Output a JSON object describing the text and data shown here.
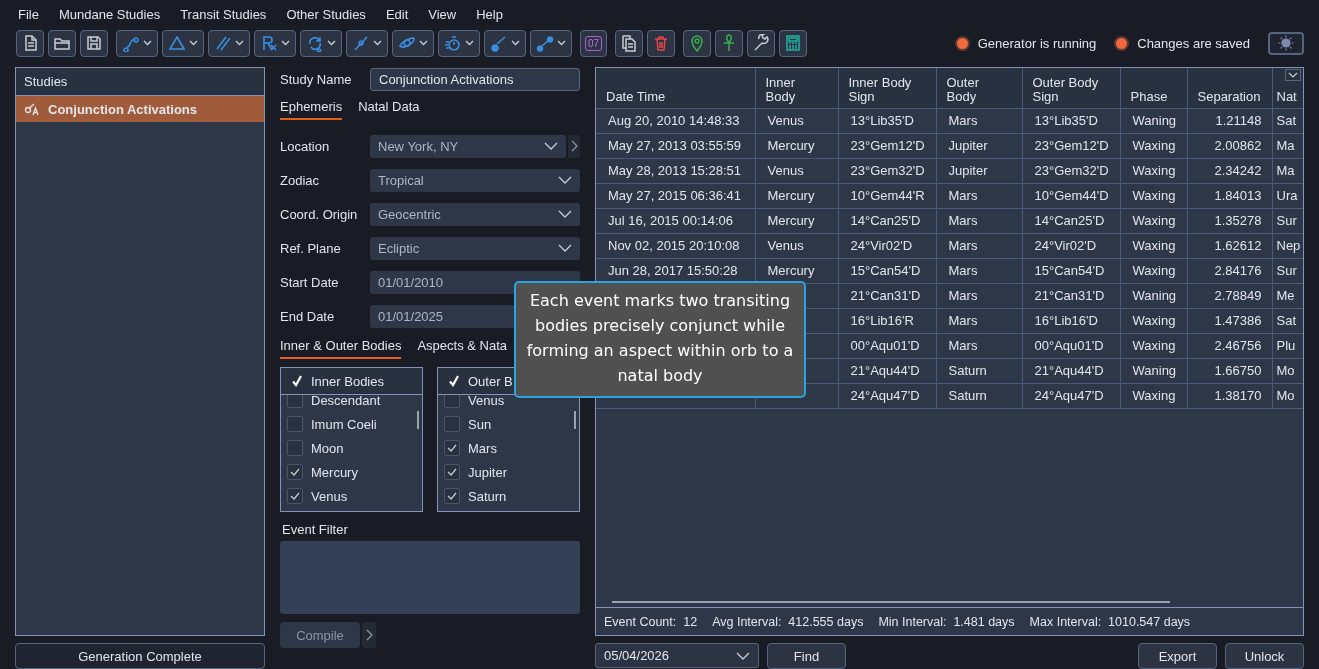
{
  "menu": [
    "File",
    "Mundane Studies",
    "Transit Studies",
    "Other Studies",
    "Edit",
    "View",
    "Help"
  ],
  "toolbar": {
    "calendar_day": "07"
  },
  "status": [
    {
      "label": "Generator is running",
      "on": true
    },
    {
      "label": "Changes are saved",
      "on": true
    }
  ],
  "studies": {
    "title": "Studies",
    "items": [
      {
        "label": "Conjunction Activations",
        "selected": true
      }
    ],
    "button": "Generation Complete"
  },
  "study_name": {
    "label": "Study Name",
    "value": "Conjunction Activations"
  },
  "tabs": [
    {
      "label": "Ephemeris",
      "selected": true
    },
    {
      "label": "Natal Data",
      "selected": false
    }
  ],
  "fields": [
    {
      "label": "Location",
      "value": "New York, NY",
      "kind": "select",
      "side_button": true
    },
    {
      "label": "Zodiac",
      "value": "Tropical",
      "kind": "select"
    },
    {
      "label": "Coord. Origin",
      "value": "Geocentric",
      "kind": "select"
    },
    {
      "label": "Ref. Plane",
      "value": "Ecliptic",
      "kind": "select"
    },
    {
      "label": "Start Date",
      "value": "01/01/2010",
      "kind": "date"
    },
    {
      "label": "End Date",
      "value": "01/01/2025",
      "kind": "date"
    }
  ],
  "body_tabs": [
    {
      "label": "Inner & Outer Bodies",
      "selected": true
    },
    {
      "label": "Aspects & Nata",
      "selected": false
    }
  ],
  "body_lists": [
    {
      "title": "Inner Bodies",
      "checked": true,
      "items": [
        {
          "label": "Descendant",
          "checked": false
        },
        {
          "label": "Imum Coeli",
          "checked": false
        },
        {
          "label": "Moon",
          "checked": false
        },
        {
          "label": "Mercury",
          "checked": true
        },
        {
          "label": "Venus",
          "checked": true
        }
      ]
    },
    {
      "title": "Outer B",
      "checked": true,
      "items": [
        {
          "label": "Venus",
          "checked": false
        },
        {
          "label": "Sun",
          "checked": false
        },
        {
          "label": "Mars",
          "checked": true
        },
        {
          "label": "Jupiter",
          "checked": true
        },
        {
          "label": "Saturn",
          "checked": true
        }
      ]
    }
  ],
  "event_filter": {
    "label": "Event Filter"
  },
  "compile": {
    "label": "Compile",
    "disabled": true
  },
  "table": {
    "columns": [
      {
        "label": "Date Time"
      },
      {
        "label": "Inner Body"
      },
      {
        "label": "Inner Body Sign"
      },
      {
        "label": "Outer Body"
      },
      {
        "label": "Outer Body Sign"
      },
      {
        "label": "Phase"
      },
      {
        "label": "Separation",
        "kind": "number"
      },
      {
        "label": "Nat"
      }
    ],
    "rows": [
      {
        "cells": [
          "Aug 20, 2010 14:48:33",
          "Venus",
          "13°Lib35'D",
          "Mars",
          "13°Lib35'D",
          "Waning",
          "1.21148",
          "Sat"
        ]
      },
      {
        "cells": [
          "May 27, 2013 03:55:59",
          "Mercury",
          "23°Gem12'D",
          "Jupiter",
          "23°Gem12'D",
          "Waxing",
          "2.00862",
          "Ma"
        ]
      },
      {
        "cells": [
          "May 28, 2013 15:28:51",
          "Venus",
          "23°Gem32'D",
          "Jupiter",
          "23°Gem32'D",
          "Waxing",
          "2.34242",
          "Ma"
        ]
      },
      {
        "cells": [
          "May 27, 2015 06:36:41",
          "Mercury",
          "10°Gem44'R",
          "Mars",
          "10°Gem44'D",
          "Waxing",
          "1.84013",
          "Ura"
        ]
      },
      {
        "cells": [
          "Jul 16, 2015 00:14:06",
          "Mercury",
          "14°Can25'D",
          "Mars",
          "14°Can25'D",
          "Waxing",
          "1.35278",
          "Sur"
        ]
      },
      {
        "cells": [
          "Nov 02, 2015 20:10:08",
          "Venus",
          "24°Vir02'D",
          "Mars",
          "24°Vir02'D",
          "Waxing",
          "1.62612",
          "Nep"
        ]
      },
      {
        "cells": [
          "Jun 28, 2017 15:50:28",
          "Mercury",
          "15°Can54'D",
          "Mars",
          "15°Can54'D",
          "Waxing",
          "2.84176",
          "Sur"
        ]
      },
      {
        "cells": [
          null,
          null,
          "21°Can31'D",
          "Mars",
          "21°Can31'D",
          "Waning",
          "2.78849",
          "Me"
        ]
      },
      {
        "cells": [
          null,
          null,
          "16°Lib16'R",
          "Mars",
          "16°Lib16'D",
          "Waxing",
          "1.47386",
          "Sat"
        ]
      },
      {
        "cells": [
          null,
          null,
          "00°Aqu01'D",
          "Mars",
          "00°Aqu01'D",
          "Waxing",
          "2.46756",
          "Plu"
        ]
      },
      {
        "cells": [
          null,
          null,
          "21°Aqu44'D",
          "Saturn",
          "21°Aqu44'D",
          "Waning",
          "1.66750",
          "Mo"
        ]
      },
      {
        "cells": [
          null,
          null,
          "24°Aqu47'D",
          "Saturn",
          "24°Aqu47'D",
          "Waxing",
          "1.38170",
          "Mo"
        ]
      }
    ]
  },
  "summary": [
    {
      "label": "Event Count:",
      "value": "12"
    },
    {
      "label": "Avg Interval:",
      "value": "412.555 days"
    },
    {
      "label": "Min Interval:",
      "value": "1.481 days"
    },
    {
      "label": "Max Interval:",
      "value": "1010.547 days"
    }
  ],
  "find_date": "05/04/2026",
  "buttons": [
    {
      "label": "Find",
      "kind": "find"
    },
    {
      "label": "Export",
      "kind": "export"
    },
    {
      "label": "Unlock",
      "kind": "unlock"
    }
  ],
  "tooltip": {
    "text": "Each event marks two transiting bodies precisely conjunct while forming an aspect within orb to a natal body"
  }
}
